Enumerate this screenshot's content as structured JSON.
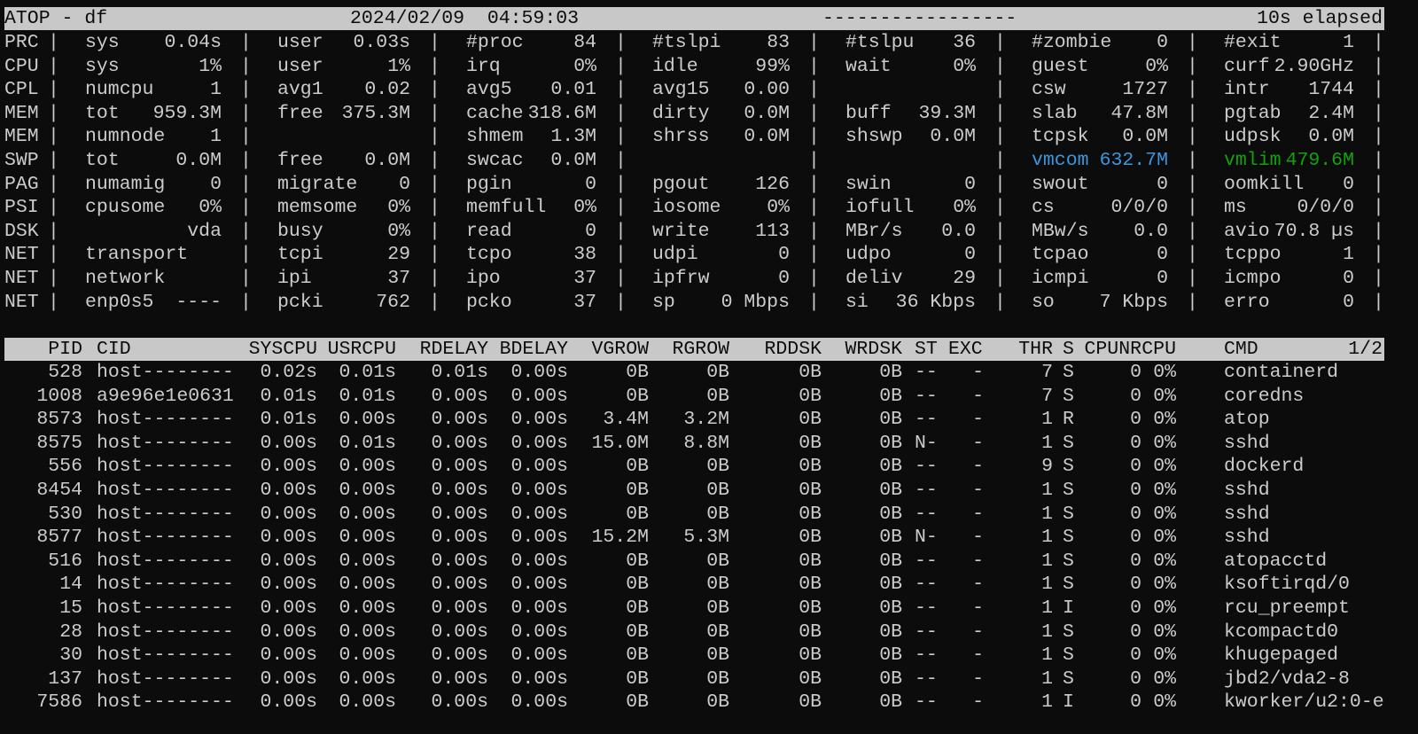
{
  "header": {
    "title": "ATOP - df",
    "datetime": "2024/02/09  04:59:03",
    "dashes": "-----------------",
    "elapsed": "10s elapsed"
  },
  "colors": {
    "background": "#0c0c0c",
    "text": "#cccccc",
    "header_bar": "#c8c8c8",
    "vmcom": "#3a96dd",
    "vmlim": "#13a10e"
  },
  "system_rows": [
    {
      "label": "PRC",
      "cells": [
        {
          "name": "sys",
          "value": "0.04s"
        },
        {
          "name": "user",
          "value": "0.03s"
        },
        {
          "name": "#proc",
          "value": "84"
        },
        {
          "name": "#tslpi",
          "value": "83"
        },
        {
          "name": "#tslpu",
          "value": "36"
        },
        {
          "name": "#zombie",
          "value": "0"
        },
        {
          "name": "#exit",
          "value": "1"
        }
      ]
    },
    {
      "label": "CPU",
      "cells": [
        {
          "name": "sys",
          "value": "1%"
        },
        {
          "name": "user",
          "value": "1%"
        },
        {
          "name": "irq",
          "value": "0%"
        },
        {
          "name": "idle",
          "value": "99%"
        },
        {
          "name": "wait",
          "value": "0%"
        },
        {
          "name": "guest",
          "value": "0%"
        },
        {
          "name": "curf",
          "value": "2.90GHz"
        }
      ]
    },
    {
      "label": "CPL",
      "cells": [
        {
          "name": "numcpu",
          "value": "1"
        },
        {
          "name": "avg1",
          "value": "0.02"
        },
        {
          "name": "avg5",
          "value": "0.01"
        },
        {
          "name": "avg15",
          "value": "0.00"
        },
        null,
        {
          "name": "csw",
          "value": "1727"
        },
        {
          "name": "intr",
          "value": "1744"
        }
      ]
    },
    {
      "label": "MEM",
      "cells": [
        {
          "name": "tot",
          "value": "959.3M"
        },
        {
          "name": "free",
          "value": "375.3M"
        },
        {
          "name": "cache",
          "value": "318.6M"
        },
        {
          "name": "dirty",
          "value": "0.0M"
        },
        {
          "name": "buff",
          "value": "39.3M"
        },
        {
          "name": "slab",
          "value": "47.8M"
        },
        {
          "name": "pgtab",
          "value": "2.4M"
        }
      ]
    },
    {
      "label": "MEM",
      "cells": [
        {
          "name": "numnode",
          "value": "1"
        },
        null,
        {
          "name": "shmem",
          "value": "1.3M"
        },
        {
          "name": "shrss",
          "value": "0.0M"
        },
        {
          "name": "shswp",
          "value": "0.0M"
        },
        {
          "name": "tcpsk",
          "value": "0.0M"
        },
        {
          "name": "udpsk",
          "value": "0.0M"
        }
      ]
    },
    {
      "label": "SWP",
      "cells": [
        {
          "name": "tot",
          "value": "0.0M"
        },
        {
          "name": "free",
          "value": "0.0M"
        },
        {
          "name": "swcac",
          "value": "0.0M"
        },
        null,
        null,
        {
          "name": "vmcom",
          "value": "632.7M",
          "color": "#3a96dd"
        },
        {
          "name": "vmlim",
          "value": "479.6M",
          "color": "#13a10e"
        }
      ]
    },
    {
      "label": "PAG",
      "cells": [
        {
          "name": "numamig",
          "value": "0"
        },
        {
          "name": "migrate",
          "value": "0"
        },
        {
          "name": "pgin",
          "value": "0"
        },
        {
          "name": "pgout",
          "value": "126"
        },
        {
          "name": "swin",
          "value": "0"
        },
        {
          "name": "swout",
          "value": "0"
        },
        {
          "name": "oomkill",
          "value": "0"
        }
      ]
    },
    {
      "label": "PSI",
      "cells": [
        {
          "name": "cpusome",
          "value": "0%"
        },
        {
          "name": "memsome",
          "value": "0%"
        },
        {
          "name": "memfull",
          "value": "0%"
        },
        {
          "name": "iosome",
          "value": "0%"
        },
        {
          "name": "iofull",
          "value": "0%"
        },
        {
          "name": "cs",
          "value": "0/0/0"
        },
        {
          "name": "ms",
          "value": "0/0/0"
        }
      ]
    },
    {
      "label": "DSK",
      "cells": [
        {
          "name": "",
          "value": "vda"
        },
        {
          "name": "busy",
          "value": "0%"
        },
        {
          "name": "read",
          "value": "0"
        },
        {
          "name": "write",
          "value": "113"
        },
        {
          "name": "MBr/s",
          "value": "0.0"
        },
        {
          "name": "MBw/s",
          "value": "0.0"
        },
        {
          "name": "avio",
          "value": "70.8 µs"
        }
      ]
    },
    {
      "label": "NET",
      "cells": [
        {
          "name": "transport",
          "value": ""
        },
        {
          "name": "tcpi",
          "value": "29"
        },
        {
          "name": "tcpo",
          "value": "38"
        },
        {
          "name": "udpi",
          "value": "0"
        },
        {
          "name": "udpo",
          "value": "0"
        },
        {
          "name": "tcpao",
          "value": "0"
        },
        {
          "name": "tcppo",
          "value": "1"
        }
      ]
    },
    {
      "label": "NET",
      "cells": [
        {
          "name": "network",
          "value": ""
        },
        {
          "name": "ipi",
          "value": "37"
        },
        {
          "name": "ipo",
          "value": "37"
        },
        {
          "name": "ipfrw",
          "value": "0"
        },
        {
          "name": "deliv",
          "value": "29"
        },
        {
          "name": "icmpi",
          "value": "0"
        },
        {
          "name": "icmpo",
          "value": "0"
        }
      ]
    },
    {
      "label": "NET",
      "cells": [
        {
          "name": "enp0s5",
          "value": "----"
        },
        {
          "name": "pcki",
          "value": "762"
        },
        {
          "name": "pcko",
          "value": "37"
        },
        {
          "name": "sp",
          "value": "0 Mbps"
        },
        {
          "name": "si",
          "value": "36 Kbps"
        },
        {
          "name": "so",
          "value": "7 Kbps"
        },
        {
          "name": "erro",
          "value": "0"
        }
      ]
    }
  ],
  "process_table": {
    "columns": [
      "PID",
      "CID",
      "SYSCPU",
      "USRCPU",
      "RDELAY",
      "BDELAY",
      "VGROW",
      "RGROW",
      "RDDSK",
      "WRDSK",
      "ST",
      "EXC",
      "THR",
      "S",
      "CPUNR",
      "CPU",
      "CMD"
    ],
    "page": "1/2",
    "rows": [
      [
        "528",
        "host--------",
        "0.02s",
        "0.01s",
        "0.01s",
        "0.00s",
        "0B",
        "0B",
        "0B",
        "0B",
        "--",
        "-",
        "7",
        "S",
        "0",
        "0%",
        "containerd"
      ],
      [
        "1008",
        "a9e96e1e0631",
        "0.01s",
        "0.01s",
        "0.00s",
        "0.00s",
        "0B",
        "0B",
        "0B",
        "0B",
        "--",
        "-",
        "7",
        "S",
        "0",
        "0%",
        "coredns"
      ],
      [
        "8573",
        "host--------",
        "0.01s",
        "0.00s",
        "0.00s",
        "0.00s",
        "3.4M",
        "3.2M",
        "0B",
        "0B",
        "--",
        "-",
        "1",
        "R",
        "0",
        "0%",
        "atop"
      ],
      [
        "8575",
        "host--------",
        "0.00s",
        "0.01s",
        "0.00s",
        "0.00s",
        "15.0M",
        "8.8M",
        "0B",
        "0B",
        "N-",
        "-",
        "1",
        "S",
        "0",
        "0%",
        "sshd"
      ],
      [
        "556",
        "host--------",
        "0.00s",
        "0.00s",
        "0.00s",
        "0.00s",
        "0B",
        "0B",
        "0B",
        "0B",
        "--",
        "-",
        "9",
        "S",
        "0",
        "0%",
        "dockerd"
      ],
      [
        "8454",
        "host--------",
        "0.00s",
        "0.00s",
        "0.00s",
        "0.00s",
        "0B",
        "0B",
        "0B",
        "0B",
        "--",
        "-",
        "1",
        "S",
        "0",
        "0%",
        "sshd"
      ],
      [
        "530",
        "host--------",
        "0.00s",
        "0.00s",
        "0.00s",
        "0.00s",
        "0B",
        "0B",
        "0B",
        "0B",
        "--",
        "-",
        "1",
        "S",
        "0",
        "0%",
        "sshd"
      ],
      [
        "8577",
        "host--------",
        "0.00s",
        "0.00s",
        "0.00s",
        "0.00s",
        "15.2M",
        "5.3M",
        "0B",
        "0B",
        "N-",
        "-",
        "1",
        "S",
        "0",
        "0%",
        "sshd"
      ],
      [
        "516",
        "host--------",
        "0.00s",
        "0.00s",
        "0.00s",
        "0.00s",
        "0B",
        "0B",
        "0B",
        "0B",
        "--",
        "-",
        "1",
        "S",
        "0",
        "0%",
        "atopacctd"
      ],
      [
        "14",
        "host--------",
        "0.00s",
        "0.00s",
        "0.00s",
        "0.00s",
        "0B",
        "0B",
        "0B",
        "0B",
        "--",
        "-",
        "1",
        "S",
        "0",
        "0%",
        "ksoftirqd/0"
      ],
      [
        "15",
        "host--------",
        "0.00s",
        "0.00s",
        "0.00s",
        "0.00s",
        "0B",
        "0B",
        "0B",
        "0B",
        "--",
        "-",
        "1",
        "I",
        "0",
        "0%",
        "rcu_preempt"
      ],
      [
        "28",
        "host--------",
        "0.00s",
        "0.00s",
        "0.00s",
        "0.00s",
        "0B",
        "0B",
        "0B",
        "0B",
        "--",
        "-",
        "1",
        "S",
        "0",
        "0%",
        "kcompactd0"
      ],
      [
        "30",
        "host--------",
        "0.00s",
        "0.00s",
        "0.00s",
        "0.00s",
        "0B",
        "0B",
        "0B",
        "0B",
        "--",
        "-",
        "1",
        "S",
        "0",
        "0%",
        "khugepaged"
      ],
      [
        "137",
        "host--------",
        "0.00s",
        "0.00s",
        "0.00s",
        "0.00s",
        "0B",
        "0B",
        "0B",
        "0B",
        "--",
        "-",
        "1",
        "S",
        "0",
        "0%",
        "jbd2/vda2-8"
      ],
      [
        "7586",
        "host--------",
        "0.00s",
        "0.00s",
        "0.00s",
        "0.00s",
        "0B",
        "0B",
        "0B",
        "0B",
        "--",
        "-",
        "1",
        "I",
        "0",
        "0%",
        "kworker/u2:0-e"
      ]
    ]
  }
}
